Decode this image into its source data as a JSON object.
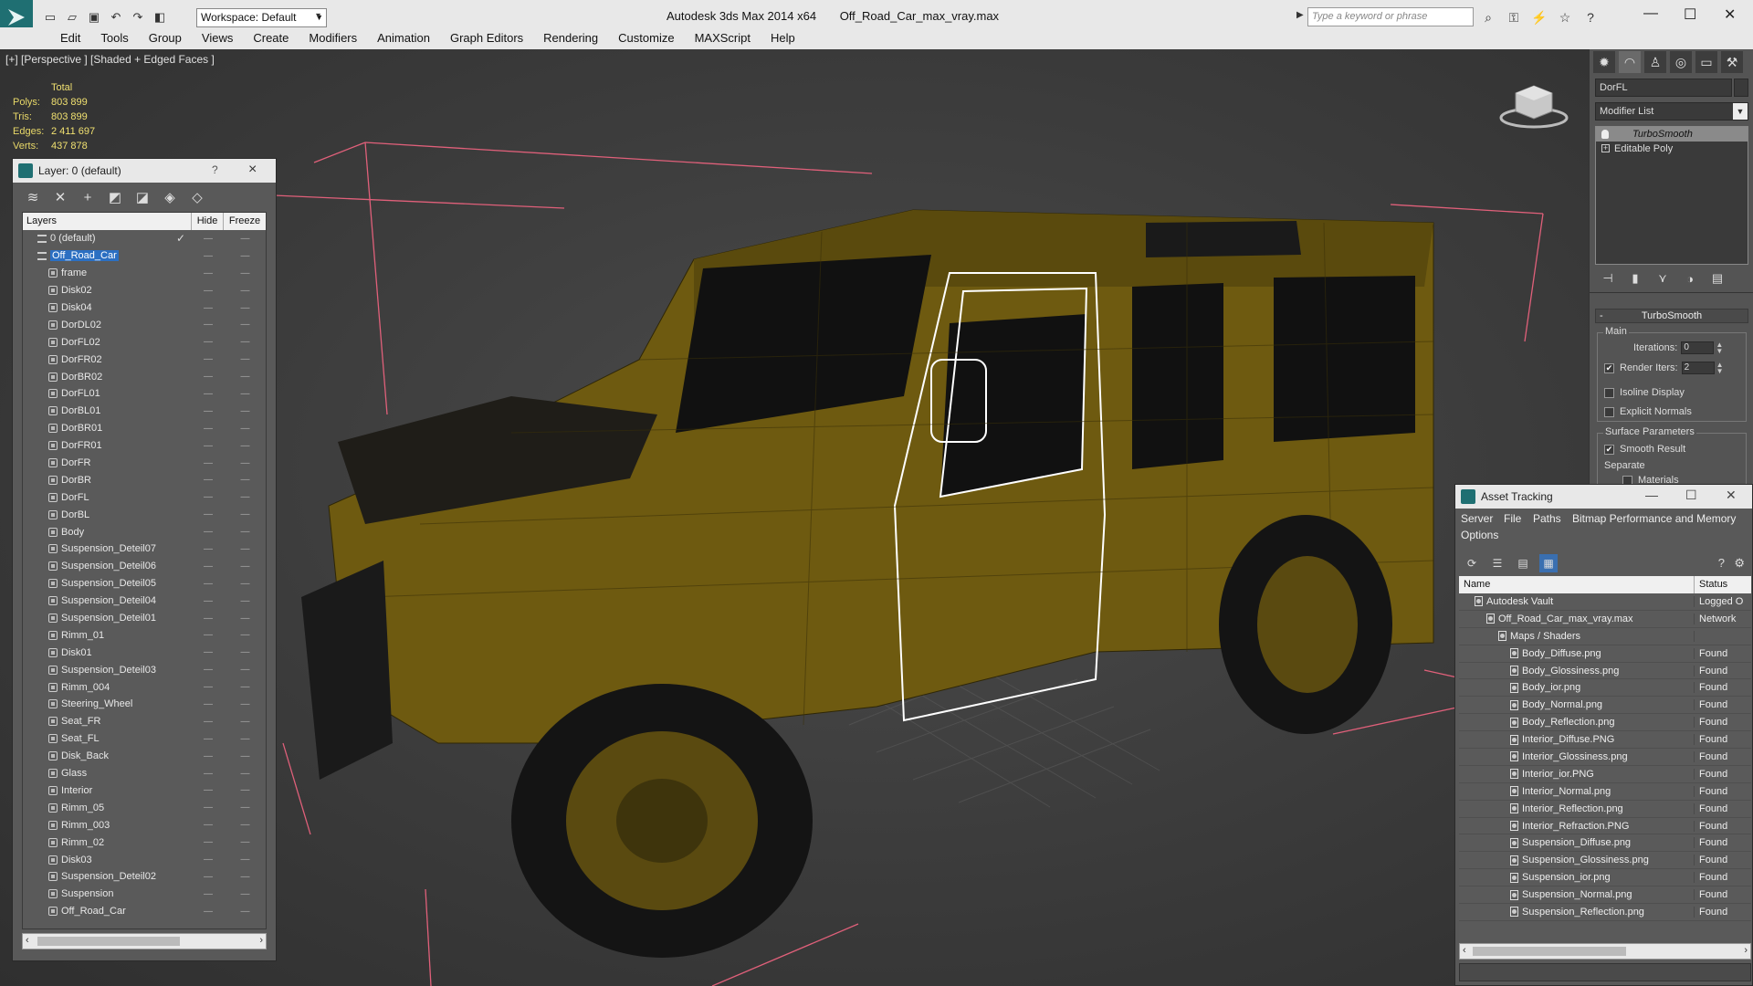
{
  "titlebar": {
    "workspace": "Workspace: Default",
    "app_name": "Autodesk 3ds Max  2014 x64",
    "file_name": "Off_Road_Car_max_vray.max",
    "search_placeholder": "Type a keyword or phrase"
  },
  "menu": [
    "Edit",
    "Tools",
    "Group",
    "Views",
    "Create",
    "Modifiers",
    "Animation",
    "Graph Editors",
    "Rendering",
    "Customize",
    "MAXScript",
    "Help"
  ],
  "viewport": {
    "label": "[+] [Perspective ] [Shaded + Edged Faces ]",
    "stats": {
      "header": "Total",
      "rows": [
        {
          "label": "Polys:",
          "value": "803 899"
        },
        {
          "label": "Tris:",
          "value": "803 899"
        },
        {
          "label": "Edges:",
          "value": "2 411 697"
        },
        {
          "label": "Verts:",
          "value": "437 878"
        }
      ]
    }
  },
  "layer_dialog": {
    "title": "Layer: 0 (default)",
    "help": "?",
    "columns": {
      "layers": "Layers",
      "hide": "Hide",
      "freeze": "Freeze"
    },
    "layers": [
      {
        "name": "0 (default)",
        "type": "layer",
        "indent": 1,
        "checked": true
      },
      {
        "name": "Off_Road_Car",
        "type": "layer",
        "indent": 1,
        "selected": true
      },
      {
        "name": "frame",
        "type": "object",
        "indent": 2
      },
      {
        "name": "Disk02",
        "type": "object",
        "indent": 2
      },
      {
        "name": "Disk04",
        "type": "object",
        "indent": 2
      },
      {
        "name": "DorDL02",
        "type": "object",
        "indent": 2
      },
      {
        "name": "DorFL02",
        "type": "object",
        "indent": 2
      },
      {
        "name": "DorFR02",
        "type": "object",
        "indent": 2
      },
      {
        "name": "DorBR02",
        "type": "object",
        "indent": 2
      },
      {
        "name": "DorFL01",
        "type": "object",
        "indent": 2
      },
      {
        "name": "DorBL01",
        "type": "object",
        "indent": 2
      },
      {
        "name": "DorBR01",
        "type": "object",
        "indent": 2
      },
      {
        "name": "DorFR01",
        "type": "object",
        "indent": 2
      },
      {
        "name": "DorFR",
        "type": "object",
        "indent": 2
      },
      {
        "name": "DorBR",
        "type": "object",
        "indent": 2
      },
      {
        "name": "DorFL",
        "type": "object",
        "indent": 2
      },
      {
        "name": "DorBL",
        "type": "object",
        "indent": 2
      },
      {
        "name": "Body",
        "type": "object",
        "indent": 2
      },
      {
        "name": "Suspension_Deteil07",
        "type": "object",
        "indent": 2
      },
      {
        "name": "Suspension_Deteil06",
        "type": "object",
        "indent": 2
      },
      {
        "name": "Suspension_Deteil05",
        "type": "object",
        "indent": 2
      },
      {
        "name": "Suspension_Deteil04",
        "type": "object",
        "indent": 2
      },
      {
        "name": "Suspension_Deteil01",
        "type": "object",
        "indent": 2
      },
      {
        "name": "Rimm_01",
        "type": "object",
        "indent": 2
      },
      {
        "name": "Disk01",
        "type": "object",
        "indent": 2
      },
      {
        "name": "Suspension_Deteil03",
        "type": "object",
        "indent": 2
      },
      {
        "name": "Rimm_004",
        "type": "object",
        "indent": 2
      },
      {
        "name": "Steering_Wheel",
        "type": "object",
        "indent": 2
      },
      {
        "name": "Seat_FR",
        "type": "object",
        "indent": 2
      },
      {
        "name": "Seat_FL",
        "type": "object",
        "indent": 2
      },
      {
        "name": "Disk_Back",
        "type": "object",
        "indent": 2
      },
      {
        "name": "Glass",
        "type": "object",
        "indent": 2
      },
      {
        "name": "Interior",
        "type": "object",
        "indent": 2
      },
      {
        "name": "Rimm_05",
        "type": "object",
        "indent": 2
      },
      {
        "name": "Rimm_003",
        "type": "object",
        "indent": 2
      },
      {
        "name": "Rimm_02",
        "type": "object",
        "indent": 2
      },
      {
        "name": "Disk03",
        "type": "object",
        "indent": 2
      },
      {
        "name": "Suspension_Deteil02",
        "type": "object",
        "indent": 2
      },
      {
        "name": "Suspension",
        "type": "object",
        "indent": 2
      },
      {
        "name": "Off_Road_Car",
        "type": "object",
        "indent": 2
      }
    ]
  },
  "command_panel": {
    "object_name": "DorFL",
    "modifier_list": "Modifier List",
    "stack": [
      {
        "name": "TurboSmooth",
        "active": true
      },
      {
        "name": "Editable Poly",
        "active": false
      }
    ],
    "rollout_title": "TurboSmooth",
    "main_label": "Main",
    "iterations_label": "Iterations:",
    "iterations_value": "0",
    "render_iters_label": "Render Iters:",
    "render_iters_value": "2",
    "isoline_label": "Isoline Display",
    "explicit_label": "Explicit Normals",
    "surface_label": "Surface Parameters",
    "smooth_result_label": "Smooth Result",
    "separate_label": "Separate",
    "materials_label": "Materials"
  },
  "asset_tracking": {
    "title": "Asset Tracking",
    "menu": [
      "Server",
      "File",
      "Paths",
      "Bitmap Performance and Memory",
      "Options"
    ],
    "columns": {
      "name": "Name",
      "status": "Status"
    },
    "rows": [
      {
        "name": "Autodesk Vault",
        "status": "Logged O",
        "indent": 1,
        "icon": "vault"
      },
      {
        "name": "Off_Road_Car_max_vray.max",
        "status": "Network",
        "indent": 2,
        "icon": "max"
      },
      {
        "name": "Maps / Shaders",
        "status": "",
        "indent": 3,
        "icon": "maps"
      },
      {
        "name": "Body_Diffuse.png",
        "status": "Found",
        "indent": 4,
        "icon": "file"
      },
      {
        "name": "Body_Glossiness.png",
        "status": "Found",
        "indent": 4,
        "icon": "file"
      },
      {
        "name": "Body_ior.png",
        "status": "Found",
        "indent": 4,
        "icon": "file"
      },
      {
        "name": "Body_Normal.png",
        "status": "Found",
        "indent": 4,
        "icon": "file"
      },
      {
        "name": "Body_Reflection.png",
        "status": "Found",
        "indent": 4,
        "icon": "file"
      },
      {
        "name": "Interior_Diffuse.PNG",
        "status": "Found",
        "indent": 4,
        "icon": "file"
      },
      {
        "name": "Interior_Glossiness.png",
        "status": "Found",
        "indent": 4,
        "icon": "file"
      },
      {
        "name": "Interior_ior.PNG",
        "status": "Found",
        "indent": 4,
        "icon": "file"
      },
      {
        "name": "Interior_Normal.png",
        "status": "Found",
        "indent": 4,
        "icon": "file"
      },
      {
        "name": "Interior_Reflection.png",
        "status": "Found",
        "indent": 4,
        "icon": "file"
      },
      {
        "name": "Interior_Refraction.PNG",
        "status": "Found",
        "indent": 4,
        "icon": "file"
      },
      {
        "name": "Suspension_Diffuse.png",
        "status": "Found",
        "indent": 4,
        "icon": "file"
      },
      {
        "name": "Suspension_Glossiness.png",
        "status": "Found",
        "indent": 4,
        "icon": "file"
      },
      {
        "name": "Suspension_ior.png",
        "status": "Found",
        "indent": 4,
        "icon": "file"
      },
      {
        "name": "Suspension_Normal.png",
        "status": "Found",
        "indent": 4,
        "icon": "file"
      },
      {
        "name": "Suspension_Reflection.png",
        "status": "Found",
        "indent": 4,
        "icon": "file"
      }
    ]
  },
  "colors": {
    "stats_text": "#e8d868",
    "selection": "#2b6fc2",
    "car_body": "#6e5a10",
    "bounding_box": "#e0607a"
  }
}
